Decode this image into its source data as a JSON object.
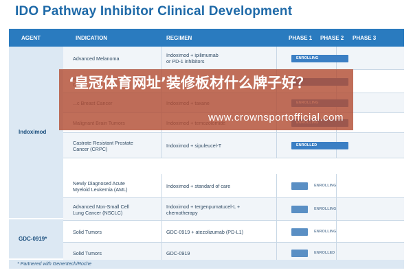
{
  "title": "IDO Pathway Inhibitor Clinical Development",
  "headers": {
    "agent": "AGENT",
    "indication": "INDICATION",
    "regimen": "REGIMEN",
    "phase1": "PHASE 1",
    "phase2": "PHASE 2",
    "phase3": "PHASE 3"
  },
  "agents": {
    "indoximod": "Indoximod",
    "gdc": "GDC-0919*"
  },
  "rows": [
    {
      "indication": "Advanced Melanoma",
      "regimen": "Indoximod + ipilimumab\nor PD-1 inhibitors",
      "status": "ENROLLING",
      "progress": 0.55
    },
    {
      "indication": "M...\nCan...",
      "regimen": "",
      "status": "",
      "progress": 0.55
    },
    {
      "indication": "...c Breast Cancer",
      "regimen": "Indoximod + taxane",
      "status": "ENROLLING",
      "progress": 0.55
    },
    {
      "indication": "Malignant Brain Tumors",
      "regimen": "Indoximod + temozolomide",
      "status": "ENROLLING",
      "progress": 0.55
    },
    {
      "indication": "Castrate Resistant Prostate\nCancer (CRPC)",
      "regimen": "Indoximod + sipuleucel-T",
      "status": "ENROLLED",
      "progress": 0.55
    },
    {
      "indication": "Newly Diagnosed Acute\nMyeloid Leukemia (AML)",
      "regimen": "Indoximod + standard of care",
      "status": "ENROLLING",
      "progress": 0.15
    },
    {
      "indication": "Advanced Non-Small Cell\nLung Cancer (NSCLC)",
      "regimen": "Indoximod + tergenpumatucel-L +\nchemotherapy",
      "status": "ENROLLING",
      "progress": 0.15
    },
    {
      "indication": "Solid Tumors",
      "regimen": "GDC-0919 + atezolizumab (PD-L1)",
      "status": "ENROLLING",
      "progress": 0.15
    },
    {
      "indication": "Solid Tumors",
      "regimen": "GDC-0919",
      "status": "ENROLLED",
      "progress": 0.15
    }
  ],
  "footnote": "* Partnered with Genentech/Roche",
  "overlay": {
    "headline": "‘皇冠体育网址’装修板材什么牌子好？",
    "url": "www.crownsportofficial.com"
  },
  "colors": {
    "header_bg": "#2a7bbf",
    "title": "#1f6aa8",
    "bar": "#3b7fc4",
    "overlay": "#b24e34"
  }
}
